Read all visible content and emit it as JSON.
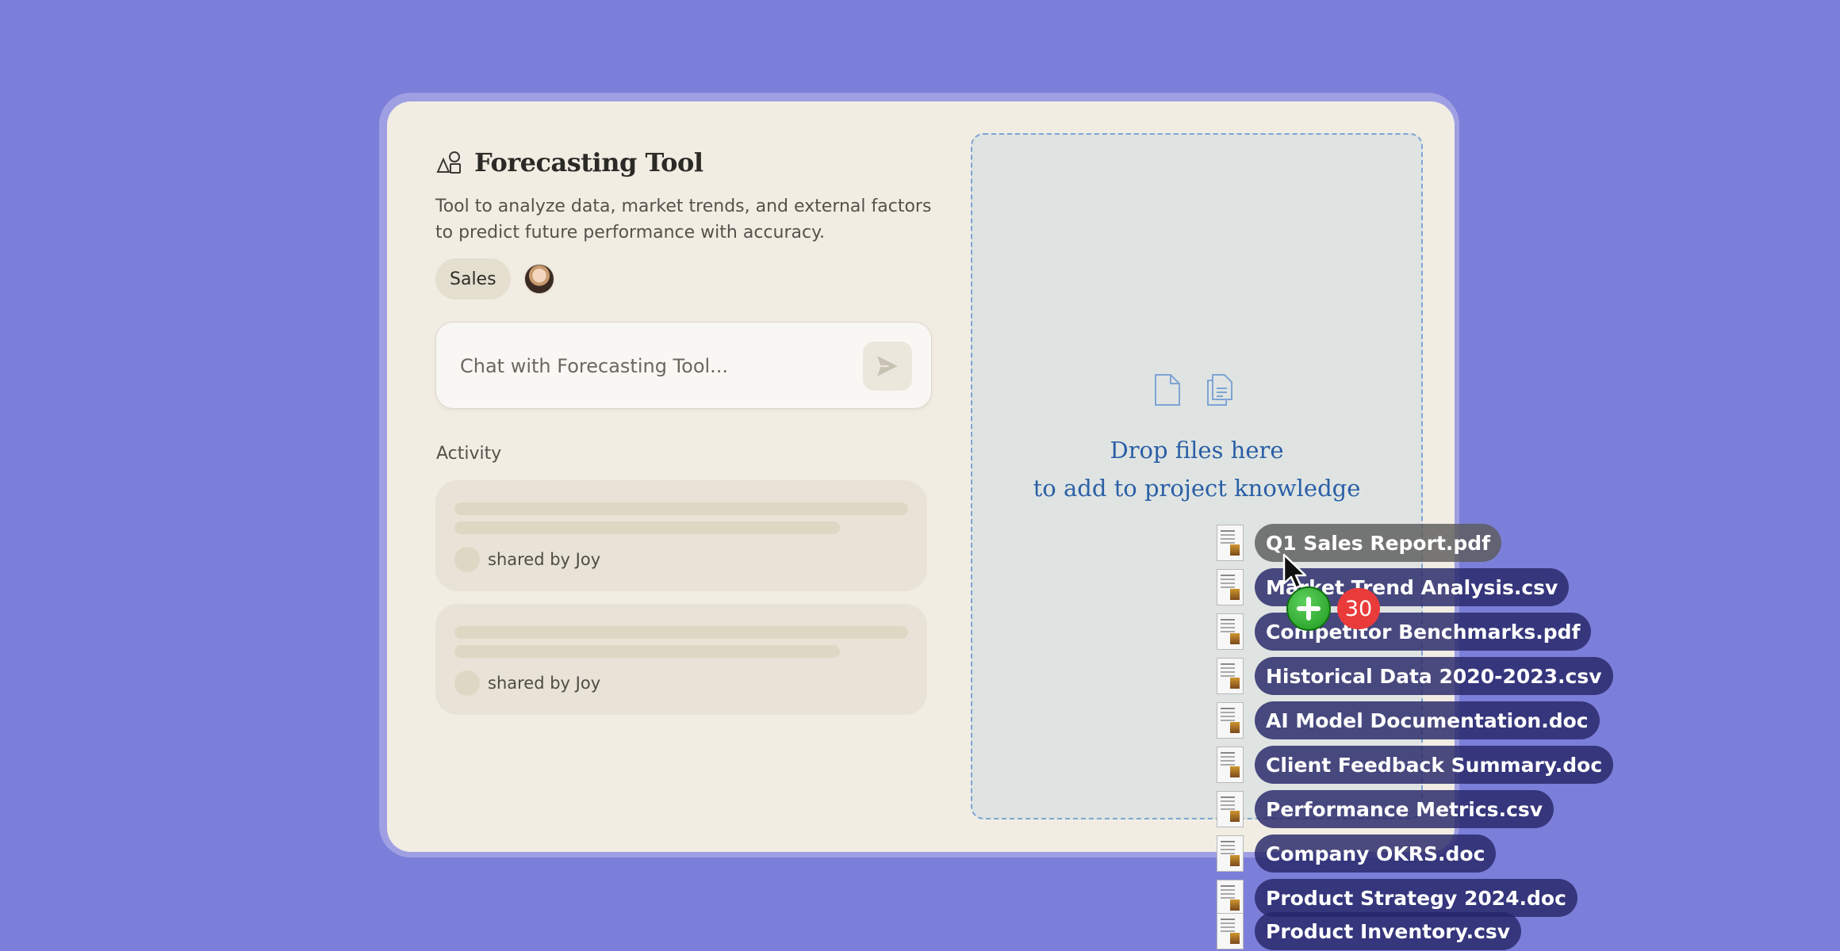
{
  "tool": {
    "title": "Forecasting Tool",
    "description": "Tool to analyze data, market trends, and external factors to predict future performance with accuracy.",
    "tag": "Sales"
  },
  "chat": {
    "placeholder": "Chat with Forecasting Tool..."
  },
  "activity": {
    "label": "Activity",
    "items": [
      {
        "shared_by": "shared by Joy"
      },
      {
        "shared_by": "shared by Joy"
      }
    ]
  },
  "drop_zone": {
    "line1": "Drop files here",
    "line2": "to add to project knowledge"
  },
  "dragged_files": {
    "count": "30",
    "files": [
      "Q1 Sales Report.pdf",
      "Market Trend Analysis.csv",
      "Competitor Benchmarks.pdf",
      "Historical Data 2020-2023.csv",
      "AI Model Documentation.doc",
      "Client Feedback Summary.doc",
      "Performance Metrics.csv",
      "Company OKRS.doc",
      "Product Strategy 2024.doc",
      "Product Inventory.csv"
    ]
  },
  "colors": {
    "background": "#7c7fd9",
    "card": "#f1ede3",
    "drop_zone": "#dfe4e2",
    "drop_text": "#2b5fa6",
    "file_pill": "#262668",
    "count_badge": "#ea3b3b",
    "copy_badge": "#1e9a1e"
  },
  "icons": [
    "shapes-icon",
    "send-icon",
    "file-icon",
    "files-icon",
    "cursor-icon",
    "plus-icon"
  ]
}
